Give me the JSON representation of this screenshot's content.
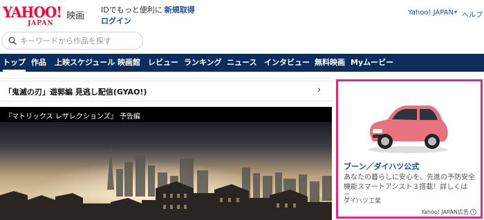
{
  "header": {
    "logo_main": "YAHOO!",
    "logo_sub": "JAPAN",
    "service": "映画",
    "id_promo": "IDでもっと便利に",
    "register_link": "新規取得",
    "login_link": "ログイン",
    "yahoo_japan_link": "Yahoo! JAPAN",
    "help_link": "ヘルプ"
  },
  "search": {
    "placeholder": "キーワードから作品を探す"
  },
  "nav": {
    "items": [
      {
        "label": "トップ",
        "active": true
      },
      {
        "label": "作品"
      },
      {
        "label": "上映スケジュール"
      },
      {
        "label": "映画館"
      },
      {
        "label": "レビュー"
      },
      {
        "label": "ランキング"
      },
      {
        "label": "ニュース"
      },
      {
        "label": "インタビュー"
      },
      {
        "label": "無料映画"
      },
      {
        "label": "Myムービー"
      }
    ]
  },
  "main": {
    "gyao_banner": "「鬼滅の刃」遊郭編 見逃し配信(GYAO!)",
    "video_title": "『マトリックス レザレクションズ』 予告編"
  },
  "ad": {
    "title": "ブーン／ダイハツ公式",
    "description": "あなたの暮らしに安心を。先進の予防安全機能スマートアシスト３搭載！詳しくはこ…",
    "sponsor": "ダイハツ工業",
    "label": "Yahoo! JAPAN広告",
    "info_icon": "i",
    "car_color": "#e8727e"
  },
  "colors": {
    "nav_bg": "#0c2e5c",
    "link": "#1a4ca1",
    "logo": "#ff0033",
    "ad_border": "#e0287d"
  }
}
